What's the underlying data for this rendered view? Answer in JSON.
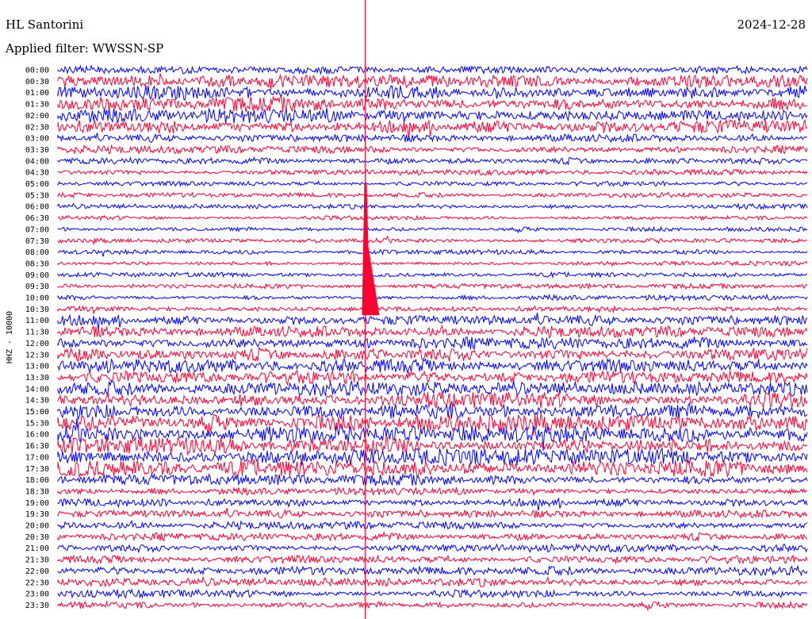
{
  "header": {
    "station": "HL Santorini",
    "date": "2024-12-28",
    "filter": "Applied filter: WWSSN-SP"
  },
  "chart_data": {
    "type": "line",
    "title": "HL Santorini",
    "ylabel": "HHZ - 10000",
    "colors": {
      "odd": "#0000ff",
      "even": "#ff0033",
      "marker": "#ff0033",
      "background": "#ffffff"
    },
    "grid": false,
    "legend": "none",
    "rows": [
      {
        "time": "00:00",
        "amplitude": 0.35
      },
      {
        "time": "00:30",
        "amplitude": 0.55
      },
      {
        "time": "01:00",
        "amplitude": 0.65
      },
      {
        "time": "01:30",
        "amplitude": 0.7
      },
      {
        "time": "02:00",
        "amplitude": 0.7
      },
      {
        "time": "02:30",
        "amplitude": 0.65
      },
      {
        "time": "03:00",
        "amplitude": 0.35
      },
      {
        "time": "03:30",
        "amplitude": 0.35
      },
      {
        "time": "04:00",
        "amplitude": 0.3
      },
      {
        "time": "04:30",
        "amplitude": 0.25
      },
      {
        "time": "05:00",
        "amplitude": 0.22
      },
      {
        "time": "05:30",
        "amplitude": 0.22
      },
      {
        "time": "06:00",
        "amplitude": 0.22
      },
      {
        "time": "06:30",
        "amplitude": 0.2
      },
      {
        "time": "07:00",
        "amplitude": 0.2
      },
      {
        "time": "07:30",
        "amplitude": 0.2
      },
      {
        "time": "08:00",
        "amplitude": 0.2
      },
      {
        "time": "08:30",
        "amplitude": 0.2
      },
      {
        "time": "09:00",
        "amplitude": 0.22
      },
      {
        "time": "09:30",
        "amplitude": 0.22
      },
      {
        "time": "10:00",
        "amplitude": 0.25
      },
      {
        "time": "10:30",
        "amplitude": 0.3
      },
      {
        "time": "11:00",
        "amplitude": 0.45
      },
      {
        "time": "11:30",
        "amplitude": 0.5
      },
      {
        "time": "12:00",
        "amplitude": 0.55
      },
      {
        "time": "12:30",
        "amplitude": 0.6
      },
      {
        "time": "13:00",
        "amplitude": 0.6
      },
      {
        "time": "13:30",
        "amplitude": 0.6
      },
      {
        "time": "14:00",
        "amplitude": 0.65
      },
      {
        "time": "14:30",
        "amplitude": 0.7
      },
      {
        "time": "15:00",
        "amplitude": 0.75
      },
      {
        "time": "15:30",
        "amplitude": 0.75
      },
      {
        "time": "16:00",
        "amplitude": 0.75
      },
      {
        "time": "16:30",
        "amplitude": 0.75
      },
      {
        "time": "17:00",
        "amplitude": 0.75
      },
      {
        "time": "17:30",
        "amplitude": 0.8
      },
      {
        "time": "18:00",
        "amplitude": 0.5
      },
      {
        "time": "18:30",
        "amplitude": 0.35
      },
      {
        "time": "19:00",
        "amplitude": 0.4
      },
      {
        "time": "19:30",
        "amplitude": 0.35
      },
      {
        "time": "20:00",
        "amplitude": 0.35
      },
      {
        "time": "20:30",
        "amplitude": 0.35
      },
      {
        "time": "21:00",
        "amplitude": 0.35
      },
      {
        "time": "21:30",
        "amplitude": 0.35
      },
      {
        "time": "22:00",
        "amplitude": 0.4
      },
      {
        "time": "22:30",
        "amplitude": 0.4
      },
      {
        "time": "23:00",
        "amplitude": 0.35
      },
      {
        "time": "23:30",
        "amplitude": 0.3
      }
    ],
    "events": [
      {
        "time": "08:30",
        "position": 0.41,
        "size": 1.0,
        "label": "",
        "peak": "10:30"
      }
    ]
  }
}
